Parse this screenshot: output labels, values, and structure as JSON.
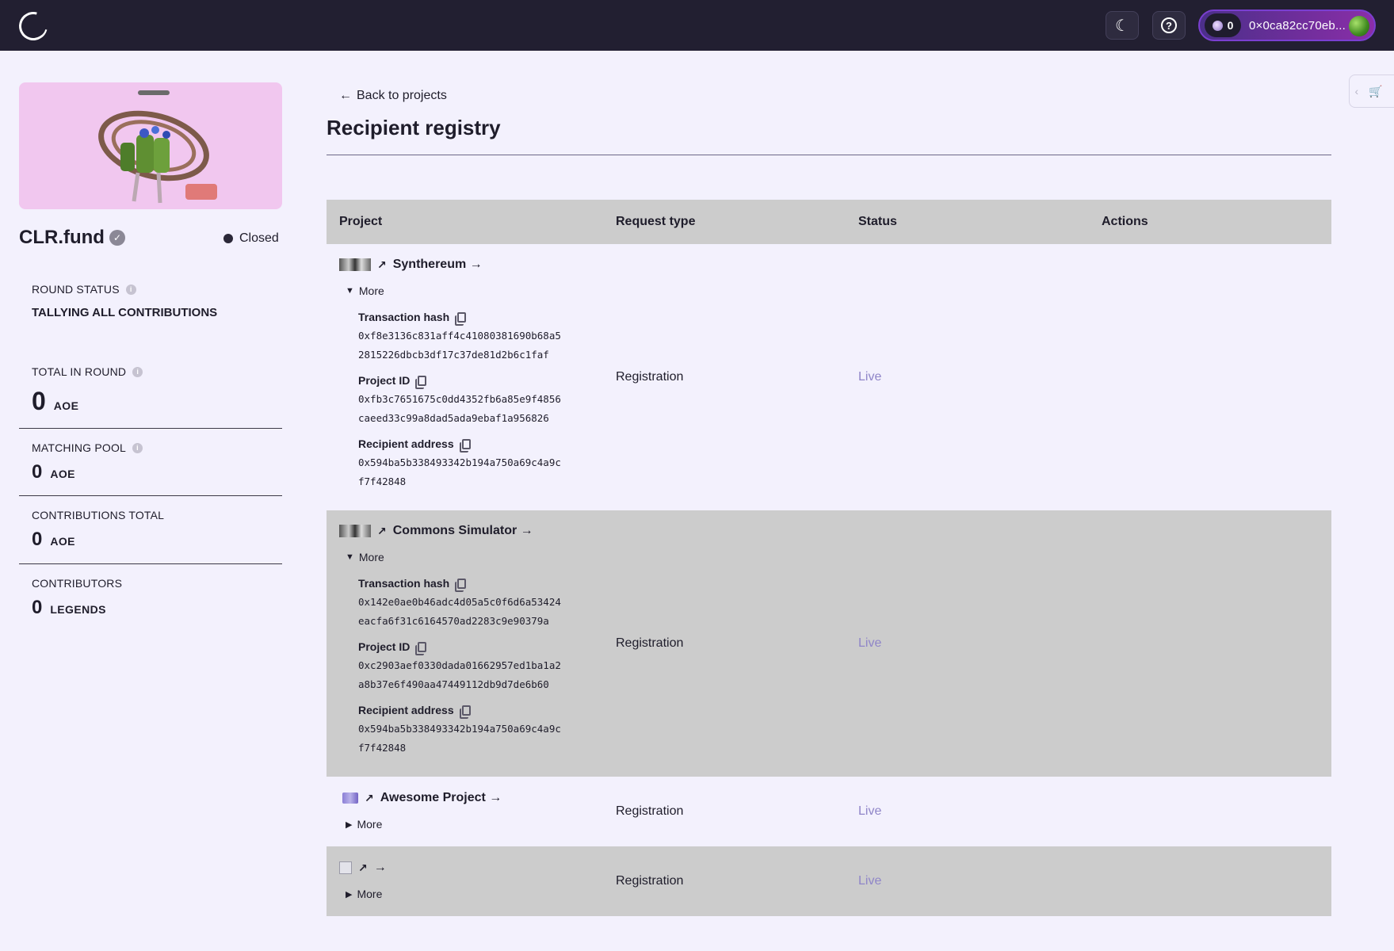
{
  "header": {
    "wallet_balance": "0",
    "wallet_address": "0×0ca82cc70eb..."
  },
  "sidebar": {
    "project_name": "CLR.fund",
    "status": "Closed",
    "round_status_label": "ROUND STATUS",
    "round_status_value": "TALLYING ALL CONTRIBUTIONS",
    "total_label": "TOTAL IN ROUND",
    "total_value": "0",
    "total_unit": "AOE",
    "matching_label": "MATCHING POOL",
    "matching_value": "0",
    "matching_unit": "AOE",
    "contrib_label": "CONTRIBUTIONS TOTAL",
    "contrib_value": "0",
    "contrib_unit": "AOE",
    "contributors_label": "CONTRIBUTORS",
    "contributors_value": "0",
    "contributors_unit": "LEGENDS"
  },
  "main": {
    "back_link": "Back to projects",
    "title": "Recipient registry",
    "columns": [
      "Project",
      "Request type",
      "Status",
      "Actions"
    ],
    "more_label": "More",
    "labels": {
      "tx": "Transaction hash",
      "pid": "Project ID",
      "addr": "Recipient address"
    },
    "rows": [
      {
        "name": "Synthereum →",
        "tx_hash_1": "0xf8e3136c831aff4c41080381690b68a5",
        "tx_hash_2": "2815226dbcb3df17c37de81d2b6c1faf",
        "project_id_1": "0xfb3c7651675c0dd4352fb6a85e9f4856",
        "project_id_2": "caeed33c99a8dad5ada9ebaf1a956826",
        "recipient_1": "0x594ba5b338493342b194a750a69c4a9c",
        "recipient_2": "f7f42848",
        "request_type": "Registration",
        "status": "Live"
      },
      {
        "name": "Commons Simulator →",
        "tx_hash_1": "0x142e0ae0b46adc4d05a5c0f6d6a53424",
        "tx_hash_2": "eacfa6f31c6164570ad2283c9e90379a",
        "project_id_1": "0xc2903aef0330dada01662957ed1ba1a2",
        "project_id_2": "a8b37e6f490aa47449112db9d7de6b60",
        "recipient_1": "0x594ba5b338493342b194a750a69c4a9c",
        "recipient_2": "f7f42848",
        "request_type": "Registration",
        "status": "Live"
      },
      {
        "name": "Awesome Project →",
        "request_type": "Registration",
        "status": "Live"
      },
      {
        "name": "→",
        "request_type": "Registration",
        "status": "Live"
      }
    ]
  }
}
